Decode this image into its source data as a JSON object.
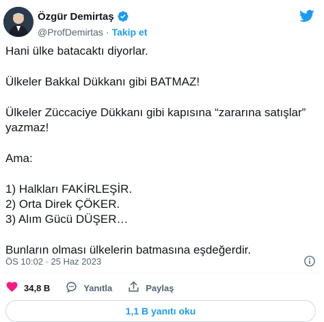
{
  "author": {
    "name": "Özgür Demirtaş",
    "handle": "@ProfDemirtas",
    "separator": "·",
    "follow_label": "Takip et",
    "verified": true
  },
  "tweet": {
    "lines": [
      "Hani ülke batacaktı diyorlar.",
      "Ülkeler Bakkal Dükkanı gibi BATMAZ!",
      "Ülkeler Züccaciye Dükkanı gibi kapısına “zararına satışlar” yazmaz!",
      "Ama:",
      "1) Halkları FAKİRLEŞİR.\n2) Orta Direk ÇÖKER.\n3) Alım Gücü DÜŞER…",
      "Bunların olması ülkelerin batmasına eşdeğerdir."
    ],
    "timestamp": "ÖS 10:02 · 25 Haz 2023"
  },
  "actions": {
    "likes_count": "34,8 B",
    "reply_label": "Yanıtla",
    "share_label": "Paylaş",
    "read_replies_label": "1,1 B yanıtı oku"
  },
  "icons": {
    "brand": "twitter-bird-icon",
    "verified": "verified-badge-icon",
    "info": "info-icon",
    "like": "heart-icon",
    "reply": "reply-bubble-icon",
    "share": "share-icon"
  },
  "colors": {
    "accent": "#1d9bf0",
    "like": "#f91880",
    "text": "#0f1419",
    "muted": "#536471"
  }
}
